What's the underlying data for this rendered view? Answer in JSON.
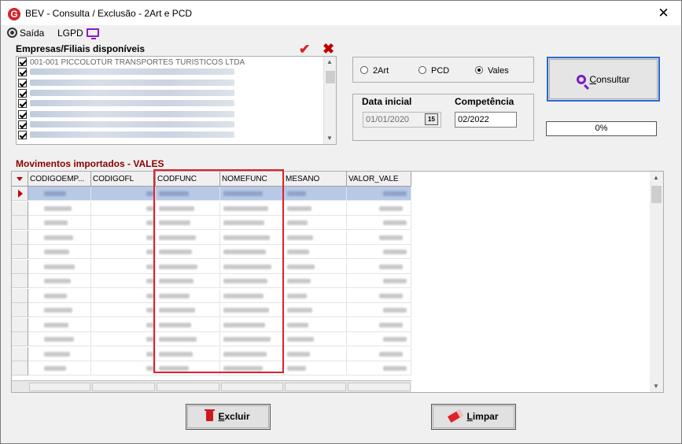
{
  "window": {
    "title": "BEV - Consulta / Exclusão - 2Art e PCD",
    "close_glyph": "✕"
  },
  "menu": {
    "saida": "Saída",
    "lgpd": "LGPD"
  },
  "empresas": {
    "label": "Empresas/Filiais disponíveis",
    "rows": [
      {
        "checked": true,
        "text": "001-001 PICCOLOTUR TRANSPORTES TURISTICOS LTDA"
      },
      {
        "checked": true,
        "text": ""
      },
      {
        "checked": true,
        "text": ""
      },
      {
        "checked": true,
        "text": ""
      },
      {
        "checked": true,
        "text": ""
      },
      {
        "checked": true,
        "text": ""
      },
      {
        "checked": true,
        "text": ""
      },
      {
        "checked": true,
        "text": ""
      }
    ]
  },
  "options": {
    "items": [
      {
        "label": "2Art",
        "selected": false
      },
      {
        "label": "PCD",
        "selected": false
      },
      {
        "label": "Vales",
        "selected": true
      }
    ]
  },
  "dates": {
    "data_inicial_label": "Data inicial",
    "data_inicial_value": "01/01/2020",
    "calendar_glyph": "15",
    "competencia_label": "Competência",
    "competencia_value": "02/2022"
  },
  "consultar": {
    "label_prefix": "",
    "label_underlined": "C",
    "label_rest": "onsultar"
  },
  "progress": {
    "text": "0%",
    "value": 0
  },
  "movimentos": {
    "label": "Movimentos importados  - VALES",
    "columns": [
      "CODIGOEMP...",
      "CODIGOFL",
      "CODFUNC",
      "NOMEFUNC",
      "MESANO",
      "VALOR_VALE"
    ],
    "row_count": 13,
    "selected_row": 0
  },
  "buttons": {
    "excluir_underlined": "E",
    "excluir_rest": "xcluir",
    "limpar_underlined": "L",
    "limpar_rest": "impar"
  },
  "colors": {
    "accent_red": "#d6232a",
    "header_red": "#8b0000",
    "selection_blue": "#b7c9e6",
    "focus_blue": "#2b6ad3",
    "icon_purple": "#7a1ec4"
  }
}
